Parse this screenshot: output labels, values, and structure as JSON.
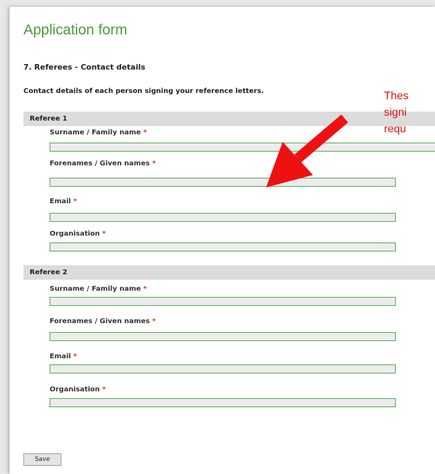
{
  "page_title": "Application form",
  "section_heading": "7. Referees - Contact details",
  "intro": "Contact details of each person signing your reference letters.",
  "required_marker": "*",
  "referees": [
    {
      "title": "Referee 1",
      "fields": [
        {
          "label": "Surname / Family name",
          "value": ""
        },
        {
          "label": "Forenames / Given names",
          "value": ""
        },
        {
          "label": "Email",
          "value": ""
        },
        {
          "label": "Organisation",
          "value": ""
        }
      ]
    },
    {
      "title": "Referee 2",
      "fields": [
        {
          "label": "Surname / Family name",
          "value": ""
        },
        {
          "label": "Forenames / Given names",
          "value": ""
        },
        {
          "label": "Email",
          "value": ""
        },
        {
          "label": "Organisation",
          "value": ""
        }
      ]
    }
  ],
  "annotation": {
    "text": "Thes\nsigni\nrequ",
    "color": "#e01010"
  },
  "save_label": "Save",
  "colors": {
    "title": "#4a9a3a",
    "field_border": "#4da64d",
    "required": "#e03030",
    "arrow": "#ee1111"
  }
}
